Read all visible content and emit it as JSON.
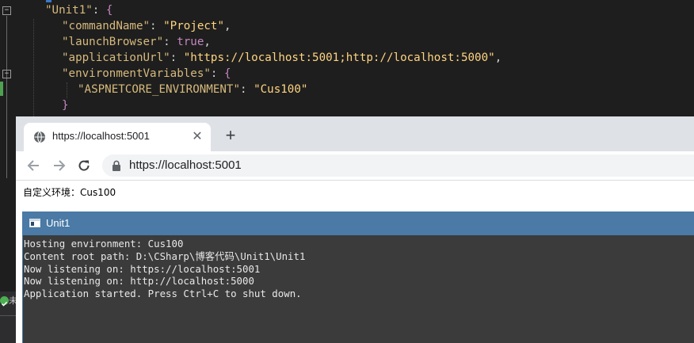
{
  "editor": {
    "lines": [
      {
        "key": "\"Unit1\"",
        "colon": ": ",
        "value": "{",
        "comma": ""
      },
      {
        "key": "\"commandName\"",
        "colon": ": ",
        "value": "\"Project\"",
        "comma": ","
      },
      {
        "key": "\"launchBrowser\"",
        "colon": ": ",
        "value": "true",
        "comma": ","
      },
      {
        "key": "\"applicationUrl\"",
        "colon": ": ",
        "value": "\"https://localhost:5001;http://localhost:5000\"",
        "comma": ","
      },
      {
        "key": "\"environmentVariables\"",
        "colon": ": ",
        "value": "{",
        "comma": ""
      },
      {
        "key": "\"ASPNETCORE_ENVIRONMENT\"",
        "colon": ": ",
        "value": "\"Cus100\"",
        "comma": ""
      },
      {
        "close": "}"
      }
    ],
    "fold_symbol": "−"
  },
  "browser": {
    "tab_title": "https://localhost:5001",
    "tab_close": "✕",
    "new_tab": "+",
    "url": "https://localhost:5001",
    "page_text": "自定义环境：Cus100"
  },
  "console": {
    "title": "Unit1",
    "lines": [
      "Hosting environment: Cus100",
      "Content root path: D:\\CSharp\\博客代码\\Unit1\\Unit1",
      "Now listening on: https://localhost:5001",
      "Now listening on: http://localhost:5000",
      "Application started. Press Ctrl+C to shut down."
    ]
  },
  "leftstrip": {
    "char": "未"
  },
  "colors": {
    "editor_bg": "#1e1e1e",
    "console_title_bg": "#4a7aa5",
    "console_bg": "#3b3b3b",
    "tabstrip_bg": "#dee1e6"
  }
}
